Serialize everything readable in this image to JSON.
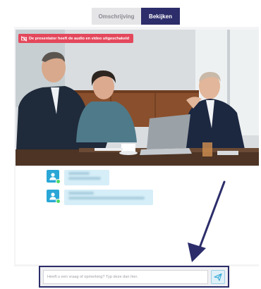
{
  "tabs": [
    {
      "label": "Omschrijving",
      "active": false
    },
    {
      "label": "Bekijken",
      "active": true
    }
  ],
  "video": {
    "alert_text": "De presentator heeft de audio en video uitgeschakeld",
    "alert_icon": "camera-off-icon"
  },
  "chat": {
    "messages": [
      {
        "avatar_icon": "user-icon",
        "online": true
      },
      {
        "avatar_icon": "user-icon",
        "online": true
      }
    ]
  },
  "question": {
    "placeholder": "Heeft u een vraag of opmerking? Typ deze dan hier.",
    "value": "",
    "send_icon": "send-icon"
  },
  "colors": {
    "brand": "#2c2d6a",
    "alert": "#e4485c",
    "avatar": "#2aa7d6",
    "bubble": "#d6eef8",
    "online": "#4cd964"
  }
}
